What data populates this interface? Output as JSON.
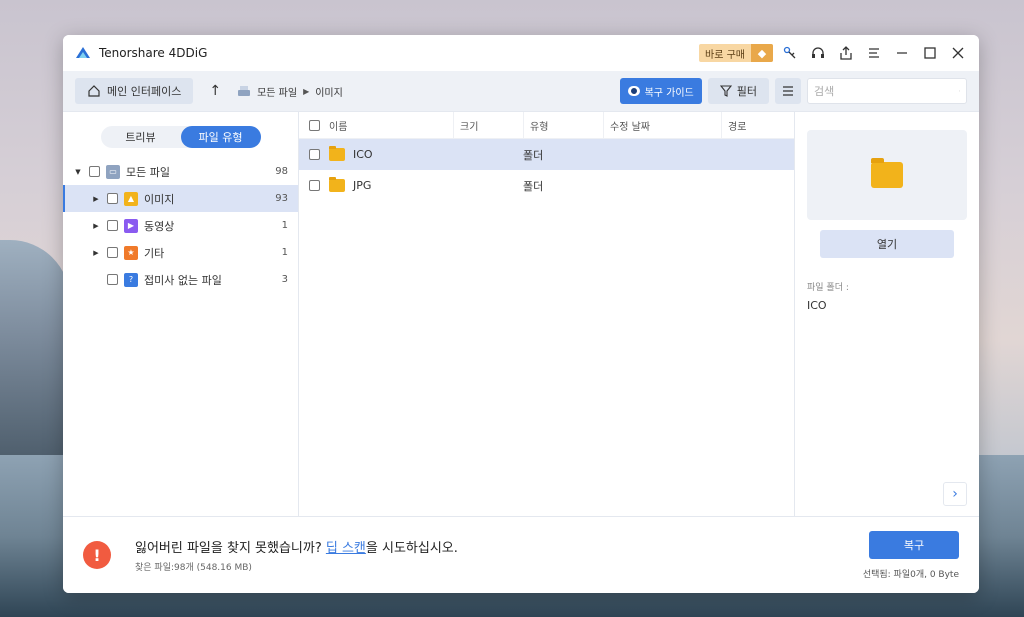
{
  "app": {
    "title": "Tenorshare 4DDiG",
    "buy_label": "바로 구매"
  },
  "toolbar": {
    "home_label": "메인 인터페이스",
    "breadcrumb": [
      "모든 파일",
      "이미지"
    ],
    "guide_label": "복구 가이드",
    "filter_label": "필터",
    "search_placeholder": "검색"
  },
  "sidebar": {
    "tabs": [
      "트리뷰",
      "파일 유형"
    ],
    "items": [
      {
        "label": "모든 파일",
        "count": "98"
      },
      {
        "label": "이미지",
        "count": "93"
      },
      {
        "label": "동영상",
        "count": "1"
      },
      {
        "label": "기타",
        "count": "1"
      },
      {
        "label": "접미사 없는 파일",
        "count": "3"
      }
    ]
  },
  "filelist": {
    "columns": [
      "이름",
      "크기",
      "유형",
      "수정 날짜",
      "경로"
    ],
    "rows": [
      {
        "name": "ICO",
        "type": "폴더"
      },
      {
        "name": "JPG",
        "type": "폴더"
      }
    ]
  },
  "preview": {
    "open_label": "열기",
    "meta_label": "파일 폴더 :",
    "meta_value": "ICO"
  },
  "footer": {
    "msg_pre": "잃어버린 파일을 찾지 못했습니까? ",
    "msg_link": "딥 스캔",
    "msg_post": "을 시도하십시오.",
    "found": "찾은 파일:98개 (548.16 MB)",
    "recover_label": "복구",
    "selected": "선택됨: 파일0개, 0 Byte"
  }
}
